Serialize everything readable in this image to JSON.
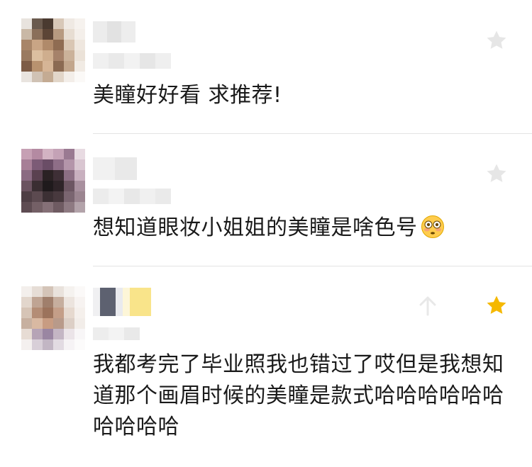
{
  "comments": [
    {
      "text": "美瞳好好看 求推荐!",
      "starred": false
    },
    {
      "text": "想知道眼妆小姐姐的美瞳是啥色号",
      "emoji": "flushed-face-emoji",
      "starred": false
    },
    {
      "text": "我都考完了毕业照我也错过了哎但是我想知道那个画眉时候的美瞳是款式哈哈哈哈哈哈哈哈哈哈",
      "starred": true
    }
  ],
  "colors": {
    "star_inactive": "#e6e6e6",
    "star_active": "#f5b800",
    "divider": "#e3e3e3",
    "text": "#1a1a1a"
  },
  "icons": [
    "star-icon",
    "up-arrow-icon",
    "flushed-face-emoji"
  ]
}
